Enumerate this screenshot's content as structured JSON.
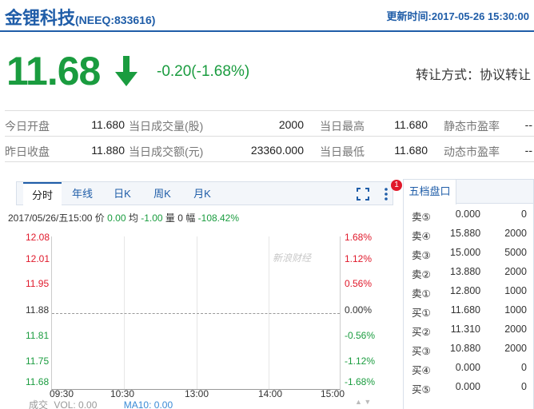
{
  "header": {
    "name": "金锂科技",
    "code": "(NEEQ:833616)",
    "update_time": "更新时间:2017-05-26 15:30:00"
  },
  "quote": {
    "price": "11.68",
    "direction": "down",
    "change": "-0.20(-1.68%)",
    "transfer_method": "转让方式：协议转让",
    "color_down": "#1a9c3f",
    "color_up": "#e0192b"
  },
  "stats": [
    [
      {
        "label": "今日开盘",
        "value": "11.680"
      },
      {
        "label": "当日成交量(股)",
        "value": "2000"
      },
      {
        "label": "当日最高",
        "value": "11.680"
      },
      {
        "label": "静态市盈率",
        "value": "--"
      }
    ],
    [
      {
        "label": "昨日收盘",
        "value": "11.880"
      },
      {
        "label": "当日成交额(元)",
        "value": "23360.000"
      },
      {
        "label": "当日最低",
        "value": "11.680"
      },
      {
        "label": "动态市盈率",
        "value": "--"
      }
    ]
  ],
  "chart_tabs": [
    {
      "label": "分时",
      "active": true
    },
    {
      "label": "年线",
      "active": false
    },
    {
      "label": "日K",
      "active": false
    },
    {
      "label": "周K",
      "active": false
    },
    {
      "label": "月K",
      "active": false
    }
  ],
  "chart_toolbar": {
    "fullscreen_icon": "fullscreen-icon",
    "more_icon": "vertical-dots-icon",
    "badge": "1"
  },
  "chart_info": {
    "datetime": "2017/05/26/五15:00",
    "price_label": "价",
    "price": "0.00",
    "avg_label": "均",
    "avg": "-1.00",
    "volume_label": "量",
    "volume": "0",
    "amp_label": "幅",
    "amp": "-108.42%"
  },
  "chart_data": {
    "type": "line",
    "x_ticks": [
      "09:30",
      "10:30",
      "13:00",
      "14:00",
      "15:00"
    ],
    "y_ticks_price": [
      "12.08",
      "12.01",
      "11.95",
      "11.88",
      "11.81",
      "11.75",
      "11.68"
    ],
    "y_ticks_pct": [
      "1.68%",
      "1.12%",
      "0.56%",
      "0.00%",
      "-0.56%",
      "-1.12%",
      "-1.68%"
    ],
    "reference_price": "11.88",
    "series": []
  },
  "watermark": "新浪财经",
  "volume_info": {
    "title": "成交",
    "vol_text": "VOL: 0.00",
    "ma10_text": "MA10: 0.00",
    "arrows": "▲ ▼"
  },
  "order_book": {
    "title": "五档盘口",
    "rows": [
      {
        "label": "卖⑤",
        "price": "0.000",
        "volume": "0"
      },
      {
        "label": "卖④",
        "price": "15.880",
        "volume": "2000"
      },
      {
        "label": "卖③",
        "price": "15.000",
        "volume": "5000"
      },
      {
        "label": "卖②",
        "price": "13.880",
        "volume": "2000"
      },
      {
        "label": "卖①",
        "price": "12.800",
        "volume": "1000"
      },
      {
        "label": "买①",
        "price": "11.680",
        "volume": "1000"
      },
      {
        "label": "买②",
        "price": "11.310",
        "volume": "2000"
      },
      {
        "label": "买③",
        "price": "10.880",
        "volume": "2000"
      },
      {
        "label": "买④",
        "price": "0.000",
        "volume": "0"
      },
      {
        "label": "买⑤",
        "price": "0.000",
        "volume": "0"
      }
    ]
  }
}
